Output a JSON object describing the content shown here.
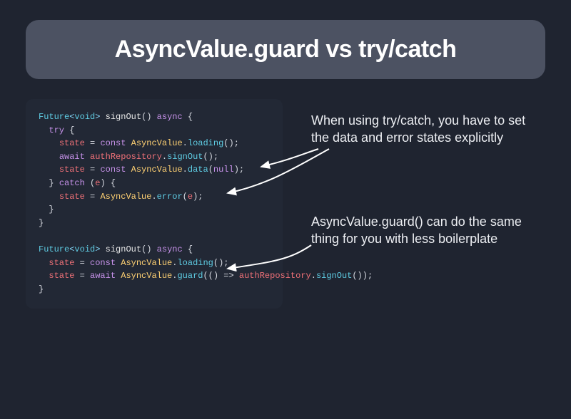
{
  "title": "AsyncValue.guard vs try/catch",
  "annotations": {
    "a1": "When using try/catch, you have to set the data and error states explicitly",
    "a2": "AsyncValue.guard() can do the same thing for you with less boilerplate"
  },
  "code": {
    "l1": {
      "Future": "Future",
      "lt": "<",
      "void": "void",
      "gt": ">",
      "sp": " ",
      "fn": "signOut",
      "paren": "()",
      "async": "async",
      "brace": " {"
    },
    "l2": {
      "indent": "  ",
      "try": "try",
      "brace": " {"
    },
    "l3": {
      "indent": "    ",
      "state": "state",
      "eq": " = ",
      "const": "const",
      "sp": " ",
      "cls": "AsyncValue",
      "dot": ".",
      "m": "loading",
      "call": "();"
    },
    "l4": {
      "indent": "    ",
      "await": "await",
      "sp": " ",
      "repo": "authRepository",
      "dot": ".",
      "m": "signOut",
      "call": "();"
    },
    "l5": {
      "indent": "    ",
      "state": "state",
      "eq": " = ",
      "const": "const",
      "sp": " ",
      "cls": "AsyncValue",
      "dot": ".",
      "m": "data",
      "open": "(",
      "null": "null",
      "close": ");"
    },
    "l6": {
      "indent": "  ",
      "brace": "} ",
      "catch": "catch",
      "paren": " (",
      "e": "e",
      "close": ") {"
    },
    "l7": {
      "indent": "    ",
      "state": "state",
      "eq": " = ",
      "cls": "AsyncValue",
      "dot": ".",
      "m": "error",
      "open": "(",
      "e": "e",
      "close": ");"
    },
    "l8": {
      "indent": "  ",
      "brace": "}"
    },
    "l9": {
      "brace": "}"
    },
    "blank": " ",
    "l10": {
      "Future": "Future",
      "lt": "<",
      "void": "void",
      "gt": ">",
      "sp": " ",
      "fn": "signOut",
      "paren": "()",
      "async": "async",
      "brace": " {"
    },
    "l11": {
      "indent": "  ",
      "state": "state",
      "eq": " = ",
      "const": "const",
      "sp": " ",
      "cls": "AsyncValue",
      "dot": ".",
      "m": "loading",
      "call": "();"
    },
    "l12": {
      "indent": "  ",
      "state": "state",
      "eq": " = ",
      "await": "await",
      "sp": " ",
      "cls": "AsyncValue",
      "dot": ".",
      "m": "guard",
      "open": "(() => ",
      "repo": "authRepository",
      "dot2": ".",
      "m2": "signOut",
      "close": "());"
    },
    "l13": {
      "brace": "}"
    }
  },
  "colors": {
    "bg": "#1f2430",
    "titleBg": "#4c5262",
    "codeBg": "#222835",
    "text": "#eceef2",
    "arrow": "#ffffff"
  }
}
